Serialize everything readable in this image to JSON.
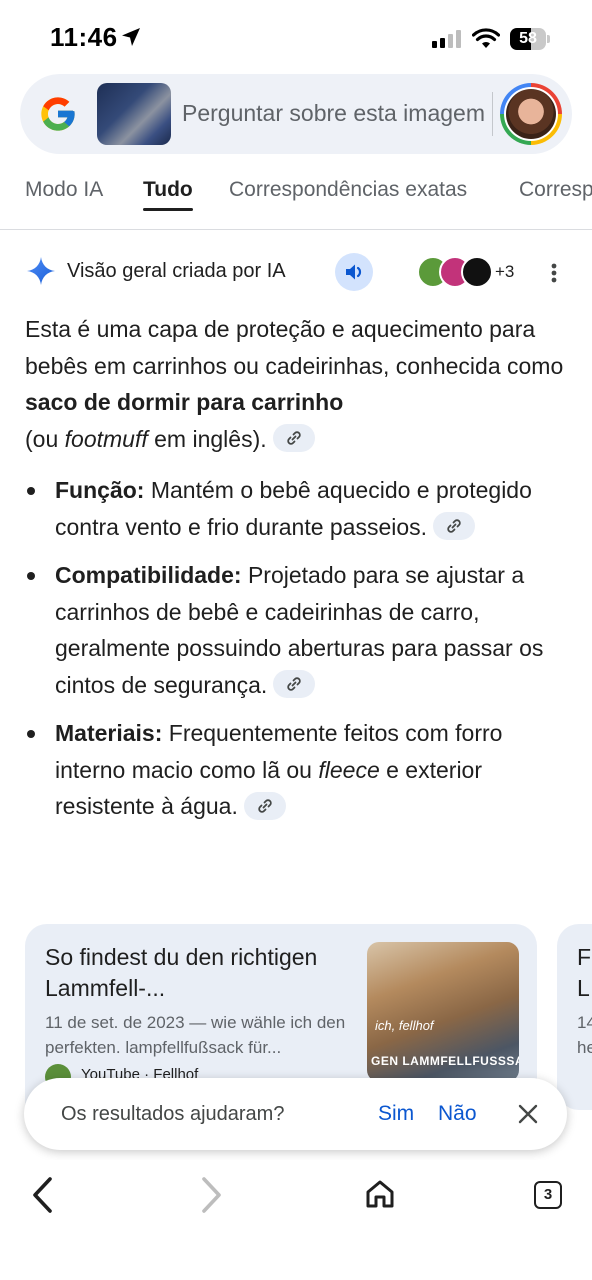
{
  "status_bar": {
    "time": "11:46",
    "battery_percent": 58,
    "battery_label": "58",
    "icons": [
      "location-arrow-icon",
      "signal-icon",
      "wifi-icon",
      "battery-icon"
    ]
  },
  "search": {
    "placeholder": "Perguntar sobre esta imagem",
    "icons": [
      "google-logo-icon",
      "thumbnail-image",
      "avatar"
    ]
  },
  "tabs": [
    {
      "label": "Modo IA",
      "active": false
    },
    {
      "label": "Tudo",
      "active": true
    },
    {
      "label": "Correspondências exatas",
      "active": false
    },
    {
      "label": "Correspondências visuais",
      "active": false
    }
  ],
  "ai_overview": {
    "title": "Visão geral criada por IA",
    "sources_more": "+3",
    "intro": {
      "part1": "Esta é uma capa de proteção e aquecimento para bebês em carrinhos ou cadeirinhas, conhecida como ",
      "bold": "saco de dormir para carrinho",
      "part2": " (ou ",
      "italic": "footmuff",
      "part3": " em inglês)."
    },
    "bullets": [
      {
        "term": "Função:",
        "text": " Mantém o bebê aquecido e protegido contra vento e frio durante passeios."
      },
      {
        "term": "Compatibilidade:",
        "text": " Projetado para se ajustar a carrinhos de bebê e cadeirinhas de carro, geralmente possuindo aberturas para passar os cintos de segurança."
      },
      {
        "term": "Materiais:",
        "text_before": " Frequentemente feitos com forro interno macio como lã ou ",
        "italic": "fleece",
        "text_after": " e exterior resistente à água."
      }
    ]
  },
  "card": {
    "title": "So findest du den richtigen Lammfell-...",
    "snippet": "11 de set. de 2023 — wie wähle ich den perfekten. lampfellfußsack für...",
    "source": "YouTube · Fellhof",
    "image_caption1": "ich, fellhof",
    "image_caption2": "GEN LAMMFELLFUSSSACK"
  },
  "card2": {
    "title_frag": "F",
    "title_frag2": "L",
    "snippet_frag": "14",
    "snippet_frag2": "he"
  },
  "feedback": {
    "question": "Os resultados ajudaram?",
    "yes": "Sim",
    "no": "Não"
  },
  "bottom_nav": {
    "tabs_count": "3"
  },
  "colors": {
    "accent": "#0b57d0",
    "chip_bg": "#e9eef6",
    "search_bg": "#eef1f7"
  }
}
